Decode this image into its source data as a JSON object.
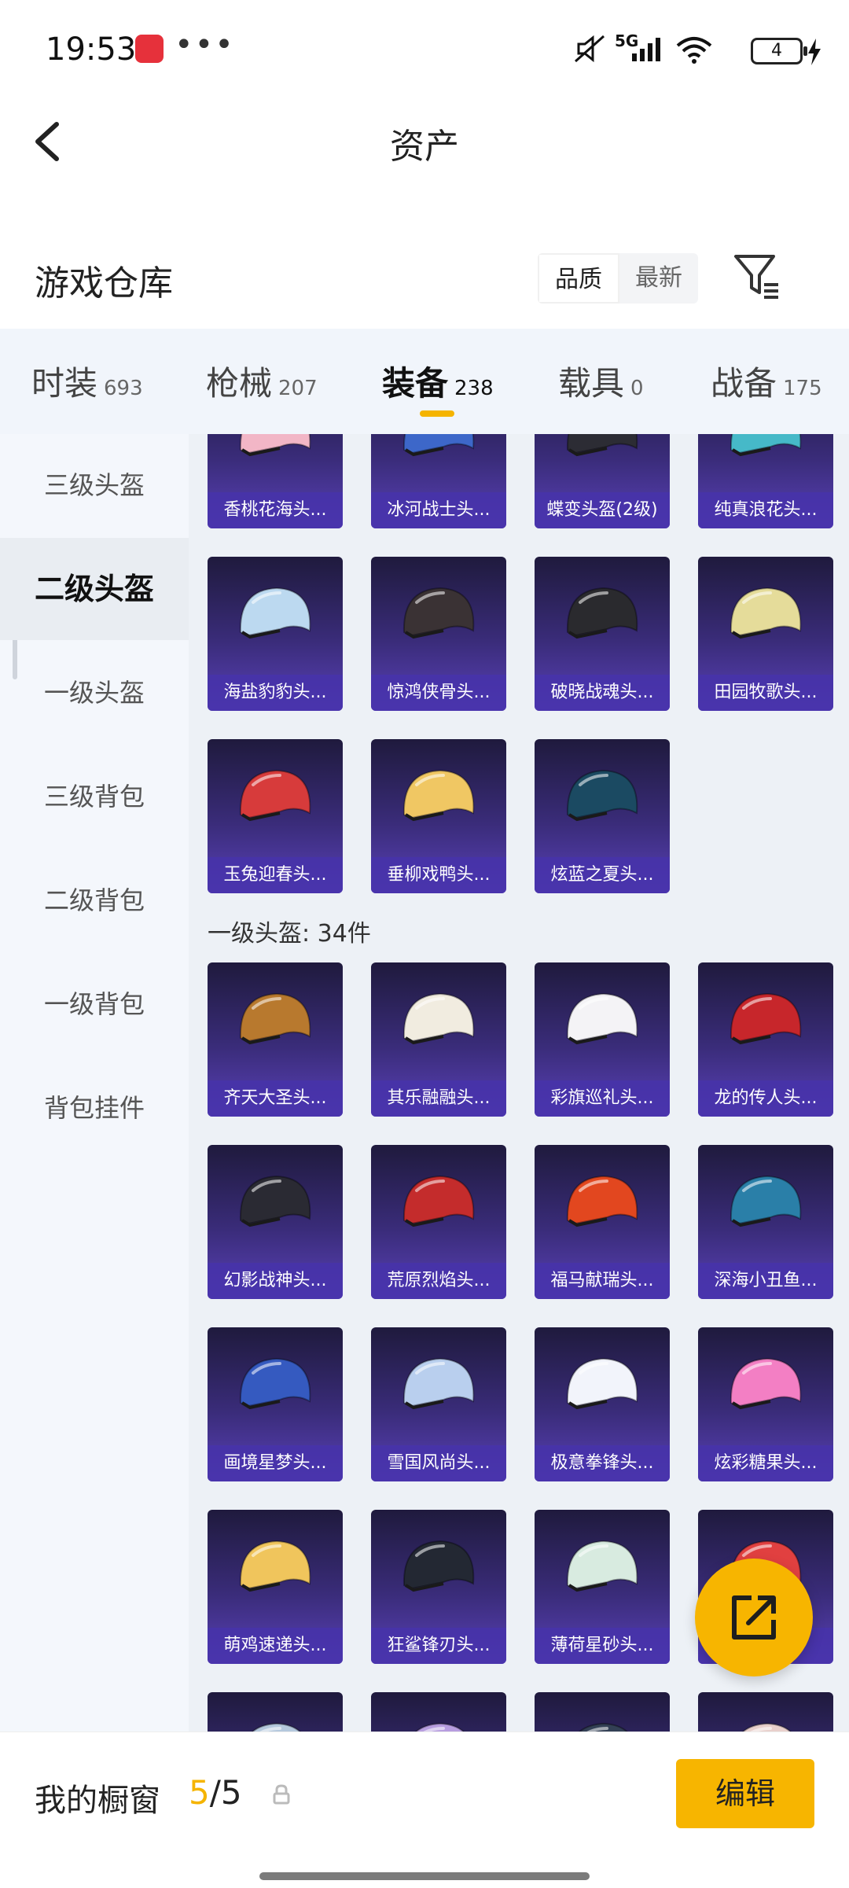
{
  "status_bar": {
    "time": "19:53",
    "dots": "•••",
    "network": "5G",
    "battery": "4"
  },
  "header": {
    "title": "资产"
  },
  "warehouse": {
    "title": "游戏仓库",
    "sort_options": [
      {
        "label": "品质",
        "active": true
      },
      {
        "label": "最新",
        "active": false
      }
    ]
  },
  "tabs": [
    {
      "name": "时装",
      "count": "693"
    },
    {
      "name": "枪械",
      "count": "207"
    },
    {
      "name": "装备",
      "count": "238",
      "active": true
    },
    {
      "name": "载具",
      "count": "0"
    },
    {
      "name": "战备",
      "count": "175"
    }
  ],
  "sidebar": [
    {
      "label": "三级头盔"
    },
    {
      "label": "二级头盔",
      "active": true
    },
    {
      "label": "一级头盔"
    },
    {
      "label": "三级背包"
    },
    {
      "label": "二级背包"
    },
    {
      "label": "一级背包"
    },
    {
      "label": "背包挂件"
    }
  ],
  "level2_items": [
    {
      "name": "香桃花海头...",
      "color": "#f2b6c6"
    },
    {
      "name": "冰河战士头...",
      "color": "#3d67c9"
    },
    {
      "name": "蝶变头盔(2级)",
      "color": "#2c2c34"
    },
    {
      "name": "纯真浪花头...",
      "color": "#46b9c8"
    },
    {
      "name": "海盐豹豹头...",
      "color": "#bcd9f0"
    },
    {
      "name": "惊鸿侠骨头...",
      "color": "#3a3234"
    },
    {
      "name": "破晓战魂头...",
      "color": "#2a2a2e"
    },
    {
      "name": "田园牧歌头...",
      "color": "#e5dc9a"
    },
    {
      "name": "玉兔迎春头...",
      "color": "#d73b3b"
    },
    {
      "name": "垂柳戏鸭头...",
      "color": "#f0c763"
    },
    {
      "name": "炫蓝之夏头...",
      "color": "#1b4a62"
    }
  ],
  "level1_group": {
    "title": "一级头盔: 34件"
  },
  "level1_items": [
    {
      "name": "齐天大圣头...",
      "color": "#b8792e"
    },
    {
      "name": "其乐融融头...",
      "color": "#f1ece0"
    },
    {
      "name": "彩旗巡礼头...",
      "color": "#f4f3f6"
    },
    {
      "name": "龙的传人头...",
      "color": "#c7262b"
    },
    {
      "name": "幻影战神头...",
      "color": "#2a2a33"
    },
    {
      "name": "荒原烈焰头...",
      "color": "#c42c2c"
    },
    {
      "name": "福马献瑞头...",
      "color": "#e2471f"
    },
    {
      "name": "深海小丑鱼...",
      "color": "#2a7fa8"
    },
    {
      "name": "画境星梦头...",
      "color": "#355ac0"
    },
    {
      "name": "雪国风尚头...",
      "color": "#b9cfee"
    },
    {
      "name": "极意拳锋头...",
      "color": "#f2f4fb"
    },
    {
      "name": "炫彩糖果头...",
      "color": "#f37fc4"
    },
    {
      "name": "萌鸡速递头...",
      "color": "#f0c55c"
    },
    {
      "name": "狂鲨锋刃头...",
      "color": "#232833"
    },
    {
      "name": "薄荷星砂头...",
      "color": "#d8ebe0"
    },
    {
      "name": "",
      "color": "#e14040"
    },
    {
      "name": "",
      "color": "#b4c8dd"
    },
    {
      "name": "",
      "color": "#b79ddf"
    },
    {
      "name": "",
      "color": "#334055"
    },
    {
      "name": "",
      "color": "#e8d0cc"
    }
  ],
  "bottom": {
    "label": "我的橱窗",
    "current": "5",
    "separator": "/",
    "max": "5",
    "edit_label": "编辑"
  }
}
